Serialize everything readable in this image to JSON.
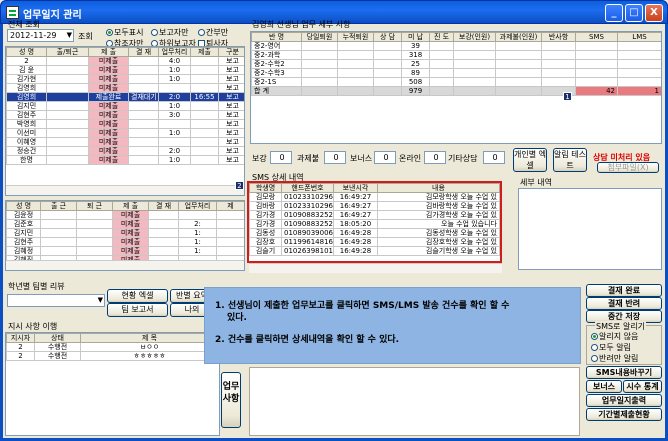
{
  "window": {
    "title": "업무일지 관리",
    "min": "_",
    "max": "□",
    "close": "X"
  },
  "left": {
    "section_title": "전체 조회",
    "date": "2012-11-29",
    "query_btn": "조회",
    "radios": [
      {
        "label": "모두표시",
        "on": true
      },
      {
        "label": "보고자만",
        "on": false
      },
      {
        "label": "간부만",
        "on": false
      },
      {
        "label": "참조자만",
        "on": false
      },
      {
        "label": "하위보고자",
        "on": false
      },
      {
        "label": "퇴사자",
        "on": false
      }
    ],
    "main_headers": [
      "성 명",
      "출/퇴근",
      "제 출",
      "결 재",
      "업무처리",
      "제출",
      "구분"
    ],
    "main_rows": [
      [
        "2",
        "",
        "미제출",
        "",
        "4:0",
        "",
        "보고"
      ],
      [
        "김 윤",
        "",
        "미제출",
        "",
        "1:0",
        "",
        "보고"
      ],
      [
        "김가현",
        "",
        "미제출",
        "",
        "1:0",
        "",
        "보고"
      ],
      [
        "김영희",
        "",
        "미제출",
        "",
        "",
        "",
        "보고"
      ],
      [
        "김영희",
        "",
        "제출완료",
        "결재대기",
        "2:0",
        "16:55",
        "보고"
      ],
      [
        "김지민",
        "",
        "미제출",
        "",
        "1:0",
        "",
        "보고"
      ],
      [
        "김현주",
        "",
        "미제출",
        "",
        "3:0",
        "",
        "보고"
      ],
      [
        "박영희",
        "",
        "미제출",
        "",
        "",
        "",
        "보고"
      ],
      [
        "이선미",
        "",
        "미제출",
        "",
        "1:0",
        "",
        "보고"
      ],
      [
        "이혜영",
        "",
        "미제출",
        "",
        "",
        "",
        "보고"
      ],
      [
        "정승건",
        "",
        "미제출",
        "",
        "2:0",
        "",
        "보고"
      ],
      [
        "한명",
        "",
        "미제출",
        "",
        "1:0",
        "",
        "보고"
      ]
    ],
    "sub_headers": [
      "성 명",
      "출 근",
      "퇴 근",
      "제 출",
      "결 재",
      "업무처리",
      "제"
    ],
    "sub_rows": [
      [
        "김윤정",
        "",
        "",
        "미제출",
        "",
        "",
        ""
      ],
      [
        "김준호",
        "",
        "",
        "미제출",
        "",
        "2:",
        ""
      ],
      [
        "김지민",
        "",
        "",
        "미제출",
        "",
        "1:",
        ""
      ],
      [
        "김현주",
        "",
        "",
        "미제출",
        "",
        "1:",
        ""
      ],
      [
        "김혜정",
        "",
        "",
        "미제출",
        "",
        "1:",
        ""
      ],
      [
        "김혜진",
        "",
        "",
        "미제출",
        "",
        "",
        ""
      ]
    ],
    "review_title": "학년별 팀별 리뷰",
    "btn_status": "현황 엑셀",
    "btn_class": "반별 요약",
    "btn_team": "팀 보고서",
    "btn_my": "나의",
    "instr_title": "지시 사항 이행",
    "instr_headers": [
      "지시자",
      "상태",
      "제 목"
    ],
    "instr_rows": [
      [
        "2",
        "수행전",
        "ㅂㅇㅇ"
      ],
      [
        "2",
        "수행전",
        "ㅎㅎㅎㅎㅎ"
      ]
    ],
    "vbtn": "업무사항"
  },
  "right": {
    "detail_title": "김영희 선생님 업무 세부 사항",
    "detail_headers": [
      "반 명",
      "당일퇴원",
      "누적퇴원",
      "상 담",
      "미 납",
      "진 도",
      "보강(인원)",
      "과제불(인원)",
      "반사항",
      "SMS",
      "LMS"
    ],
    "detail_rows": [
      [
        "중2-영어",
        "",
        "",
        "",
        "39",
        "",
        "",
        "",
        "",
        "",
        ""
      ],
      [
        "중2-과학",
        "",
        "",
        "",
        "318",
        "",
        "",
        "",
        "",
        "",
        ""
      ],
      [
        "중2-수학2",
        "",
        "",
        "",
        "25",
        "",
        "",
        "",
        "",
        "",
        ""
      ],
      [
        "중2-수학3",
        "",
        "",
        "",
        "89",
        "",
        "",
        "",
        "",
        "",
        ""
      ],
      [
        "중2-1S",
        "",
        "",
        "",
        "508",
        "",
        "",
        "",
        "",
        "",
        ""
      ],
      [
        "합 계",
        "",
        "",
        "",
        "979",
        "",
        "",
        "",
        "",
        "42",
        "1"
      ]
    ],
    "counts": [
      {
        "label": "보강",
        "value": "0"
      },
      {
        "label": "과제불",
        "value": "0"
      },
      {
        "label": "보너스",
        "value": "0"
      },
      {
        "label": "온라인",
        "value": "0"
      },
      {
        "label": "기타상담",
        "value": "0"
      }
    ],
    "btn_personal": "개인별 엑셀",
    "btn_alarm": "알림 테스트",
    "warn_text": "상담 미처리 있음",
    "attach_btn": "첨부파일(X)",
    "sms_title": "SMS 상세 내역",
    "sms_headers": [
      "학생명",
      "핸드폰번호",
      "보낸시각",
      "내용"
    ],
    "sms_rows": [
      [
        "김모랑",
        "01023310296",
        "16:49:27",
        "김모랑학생 오늘 수업 있"
      ],
      [
        "김바랑",
        "01023310296",
        "16:49:27",
        "김바랑학생 오늘 수업 있"
      ],
      [
        "김가경",
        "01090883252",
        "16:49:27",
        "김가경학생 오늘 수업 있"
      ],
      [
        "김가경",
        "01090883252",
        "18:05:20",
        "오늘 수업 있습니다"
      ],
      [
        "김동성",
        "01089039006",
        "16:49:28",
        "김동성학생 오늘 수업 있"
      ],
      [
        "김장호",
        "01199614816",
        "16:49:28",
        "김장호학생 오늘 수업 있"
      ],
      [
        "김슬기",
        "01026398101",
        "16:49:28",
        "김슬기학생 오늘 수업 있"
      ]
    ],
    "detail_box_title": "세부 내역",
    "buttons": {
      "approve": "결재 완료",
      "reject": "결재 반려",
      "save": "중간 저장"
    },
    "sms_alarm_title": "SMS로 알리기",
    "sms_alarm_opts": [
      {
        "label": "알리지 않음",
        "on": true
      },
      {
        "label": "모두 알림",
        "on": false
      },
      {
        "label": "반려만 알림",
        "on": false
      }
    ],
    "btn_sms_change": "SMS내용바꾸기",
    "btn_bonus": "보너스",
    "btn_hours": "시수 통계",
    "btn_print": "업무일지출력",
    "btn_period": "기간별제출현황"
  },
  "badges": {
    "b1": "1",
    "b2": "2"
  },
  "tooltip": {
    "line1": "1. 선생님이 제출한 업무보고를 클릭하면 SMS/LMS 발송 건수를 확인 할 수",
    "line1b": "있다.",
    "line2": "2. 건수를 클릭하면 상세내역을 확인 할 수 있다."
  }
}
